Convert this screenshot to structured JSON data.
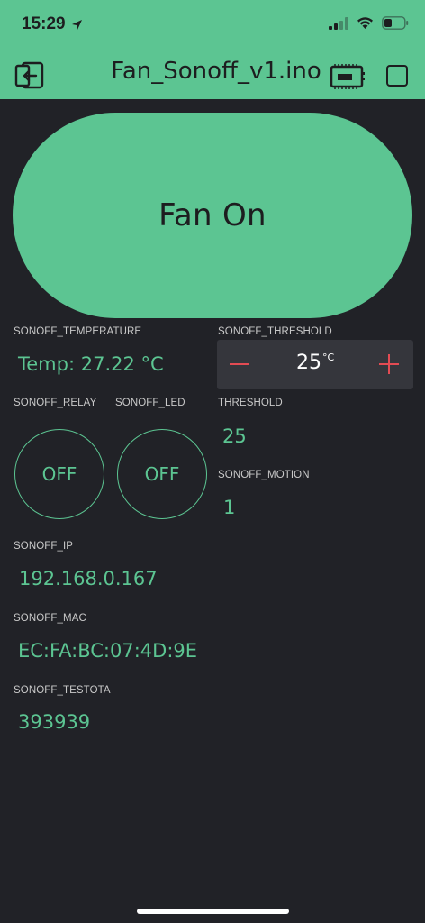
{
  "status_bar": {
    "time": "15:29"
  },
  "header": {
    "title": "Fan_Sonoff_v1.ino"
  },
  "main_button": {
    "label": "Fan On"
  },
  "widgets": {
    "temperature": {
      "label": "SONOFF_TEMPERATURE",
      "value": "Temp: 27.22 °C"
    },
    "threshold_stepper": {
      "label": "SONOFF_THRESHOLD",
      "value": "25",
      "unit": "°C"
    },
    "relay": {
      "label": "SONOFF_RELAY",
      "state": "OFF"
    },
    "led": {
      "label": "SONOFF_LED",
      "state": "OFF"
    },
    "threshold": {
      "label": "THRESHOLD",
      "value": "25"
    },
    "motion": {
      "label": "SONOFF_MOTION",
      "value": "1"
    },
    "ip": {
      "label": "SONOFF_IP",
      "value": "192.168.0.167"
    },
    "mac": {
      "label": "SONOFF_MAC",
      "value": "EC:FA:BC:07:4D:9E"
    },
    "testota": {
      "label": "SONOFF_TESTOTA",
      "value": "393939"
    }
  },
  "colors": {
    "accent": "#5CC592",
    "background": "#212227",
    "stepper_icons": "#E34B53"
  }
}
